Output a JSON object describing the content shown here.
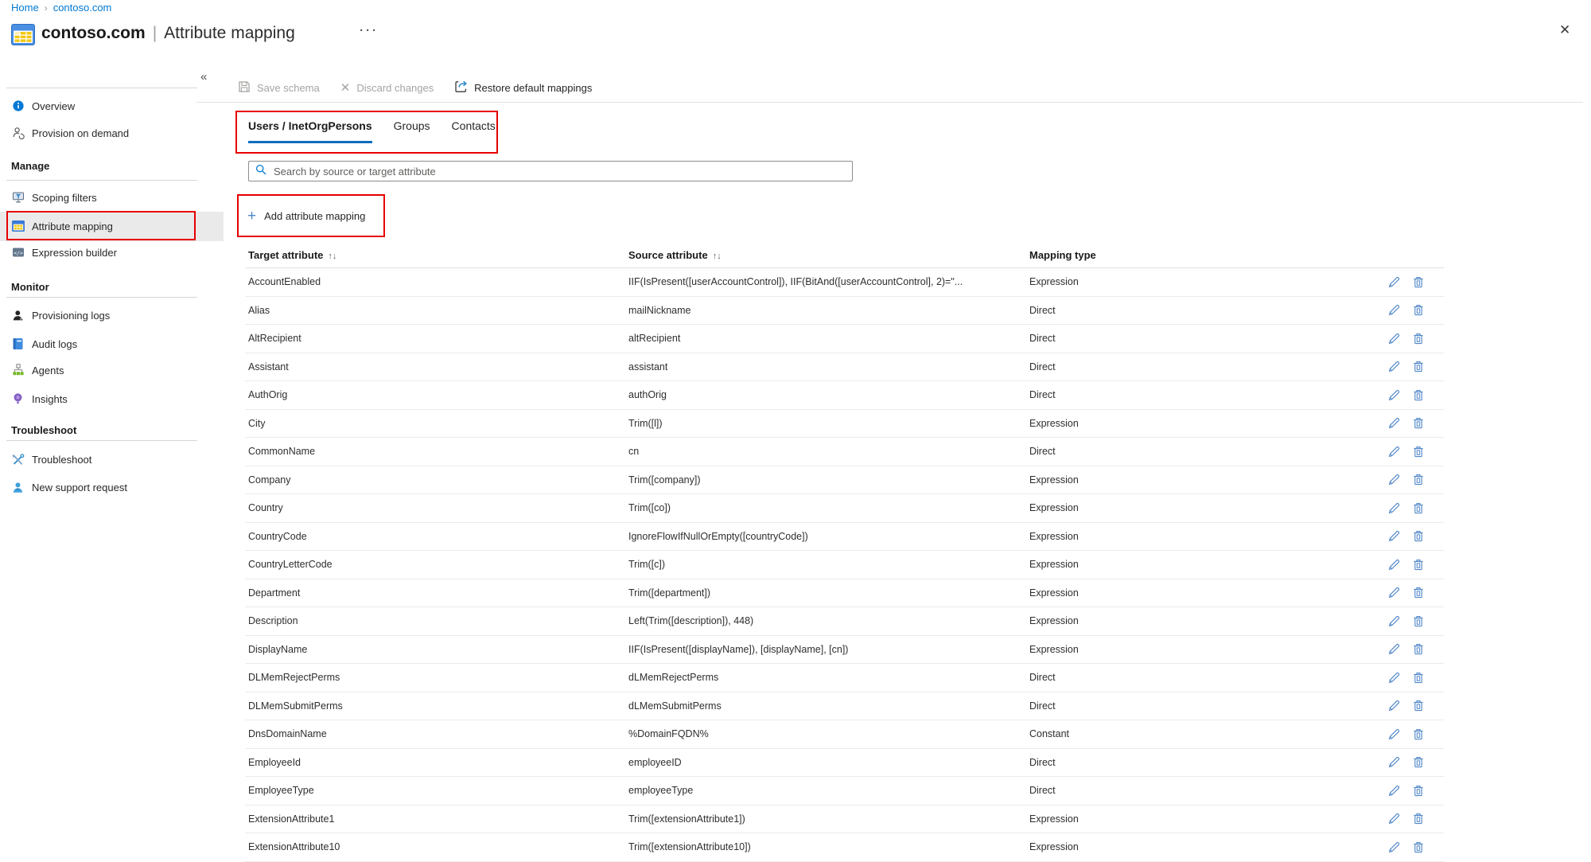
{
  "colors": {
    "accent_blue": "#0078d4",
    "tab_underline_blue": "#0f6cbd",
    "annotation_red": "#e60000",
    "row_action_blue": "#4f86c8",
    "selected_item_bg": "#eaeaea",
    "disabled_gray": "#a6a4a2"
  },
  "breadcrumb": {
    "items": [
      "Home",
      "contoso.com"
    ],
    "separator": "›"
  },
  "header": {
    "resource": "contoso.com",
    "divider": "|",
    "page": "Attribute mapping",
    "overflow_icon": "···",
    "close_icon": "✕"
  },
  "sidebar": {
    "collapse_icon": "«",
    "items_top": [
      {
        "label": "Overview"
      },
      {
        "label": "Provision on demand"
      }
    ],
    "sections": [
      {
        "title": "Manage",
        "items": [
          {
            "label": "Scoping filters"
          },
          {
            "label": "Attribute mapping",
            "selected": true,
            "annotated": true
          },
          {
            "label": "Expression builder"
          }
        ]
      },
      {
        "title": "Monitor",
        "items": [
          {
            "label": "Provisioning logs"
          },
          {
            "label": "Audit logs"
          },
          {
            "label": "Agents"
          },
          {
            "label": "Insights"
          }
        ]
      },
      {
        "title": "Troubleshoot",
        "items": [
          {
            "label": "Troubleshoot"
          },
          {
            "label": "New support request"
          }
        ]
      }
    ]
  },
  "toolbar": {
    "buttons": [
      {
        "label": "Save schema",
        "disabled": true
      },
      {
        "label": "Discard changes",
        "disabled": true
      },
      {
        "label": "Restore default mappings",
        "disabled": false
      }
    ],
    "discard_icon_glyph": "✕"
  },
  "tabs": [
    {
      "label": "Users / InetOrgPersons",
      "active": true
    },
    {
      "label": "Groups",
      "active": false
    },
    {
      "label": "Contacts",
      "active": false
    }
  ],
  "search": {
    "placeholder": "Search by source or target attribute"
  },
  "add_mapping": {
    "plus_icon": "+",
    "label": "Add attribute mapping"
  },
  "table": {
    "sort_icon": "↑↓",
    "columns": [
      {
        "label": "Target attribute",
        "sortable": true
      },
      {
        "label": "Source attribute",
        "sortable": true
      },
      {
        "label": "Mapping type",
        "sortable": false
      }
    ],
    "rows": [
      [
        "AccountEnabled",
        "IIF(IsPresent([userAccountControl]), IIF(BitAnd([userAccountControl], 2)=\"...",
        "Expression"
      ],
      [
        "Alias",
        "mailNickname",
        "Direct"
      ],
      [
        "AltRecipient",
        "altRecipient",
        "Direct"
      ],
      [
        "Assistant",
        "assistant",
        "Direct"
      ],
      [
        "AuthOrig",
        "authOrig",
        "Direct"
      ],
      [
        "City",
        "Trim([l])",
        "Expression"
      ],
      [
        "CommonName",
        "cn",
        "Direct"
      ],
      [
        "Company",
        "Trim([company])",
        "Expression"
      ],
      [
        "Country",
        "Trim([co])",
        "Expression"
      ],
      [
        "CountryCode",
        "IgnoreFlowIfNullOrEmpty([countryCode])",
        "Expression"
      ],
      [
        "CountryLetterCode",
        "Trim([c])",
        "Expression"
      ],
      [
        "Department",
        "Trim([department])",
        "Expression"
      ],
      [
        "Description",
        "Left(Trim([description]), 448)",
        "Expression"
      ],
      [
        "DisplayName",
        "IIF(IsPresent([displayName]), [displayName], [cn])",
        "Expression"
      ],
      [
        "DLMemRejectPerms",
        "dLMemRejectPerms",
        "Direct"
      ],
      [
        "DLMemSubmitPerms",
        "dLMemSubmitPerms",
        "Direct"
      ],
      [
        "DnsDomainName",
        "%DomainFQDN%",
        "Constant"
      ],
      [
        "EmployeeId",
        "employeeID",
        "Direct"
      ],
      [
        "EmployeeType",
        "employeeType",
        "Direct"
      ],
      [
        "ExtensionAttribute1",
        "Trim([extensionAttribute1])",
        "Expression"
      ],
      [
        "ExtensionAttribute10",
        "Trim([extensionAttribute10])",
        "Expression"
      ]
    ]
  }
}
